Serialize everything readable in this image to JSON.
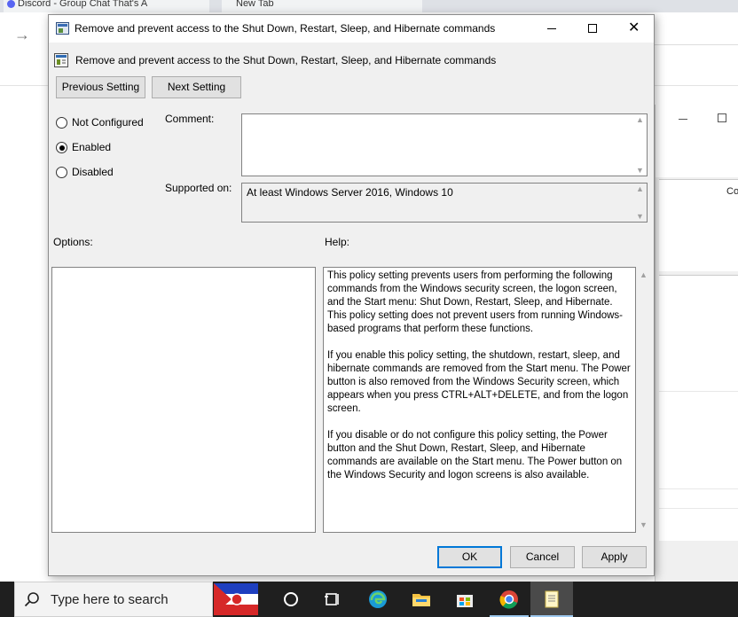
{
  "background": {
    "tab1_label": "Discord - Group Chat That's A",
    "tab2_label": "New Tab",
    "other_window_column": "Cor"
  },
  "dialog": {
    "window_title": "Remove and prevent access to the Shut Down, Restart, Sleep, and Hibernate commands",
    "header_title": "Remove and prevent access to the Shut Down, Restart, Sleep, and Hibernate commands",
    "previous_setting": "Previous Setting",
    "next_setting": "Next Setting",
    "state_options": [
      "Not Configured",
      "Enabled",
      "Disabled"
    ],
    "selected_state": "Enabled",
    "comment_label": "Comment:",
    "comment_value": "",
    "supported_label": "Supported on:",
    "supported_value": "At least Windows Server 2016, Windows 10",
    "options_label": "Options:",
    "help_label": "Help:",
    "help_text": "This policy setting prevents users from performing the following commands from the Windows security screen, the logon screen, and the Start menu: Shut Down, Restart, Sleep, and Hibernate. This policy setting does not prevent users from running Windows-based programs that perform these functions.\n\nIf you enable this policy setting, the shutdown, restart, sleep, and hibernate commands are removed from the Start menu. The Power button is also removed from the Windows Security screen, which appears when you press CTRL+ALT+DELETE, and from the logon screen.\n\nIf you disable or do not configure this policy setting, the Power button and the Shut Down, Restart, Sleep, and Hibernate commands are available on the Start menu. The Power button on the Windows Security and logon screens is also available.",
    "ok": "OK",
    "cancel": "Cancel",
    "apply": "Apply"
  },
  "taskbar": {
    "search_placeholder": "Type here to search",
    "pinned": [
      "cortana-icon",
      "task-view-icon",
      "edge-icon",
      "file-explorer-icon",
      "store-icon",
      "chrome-icon",
      "notepad-icon"
    ],
    "active_app": "notepad-icon"
  },
  "colors": {
    "dialog_bg": "#f0f0f0",
    "accent": "#0078d7",
    "taskbar_bg": "#1f1f1f"
  }
}
